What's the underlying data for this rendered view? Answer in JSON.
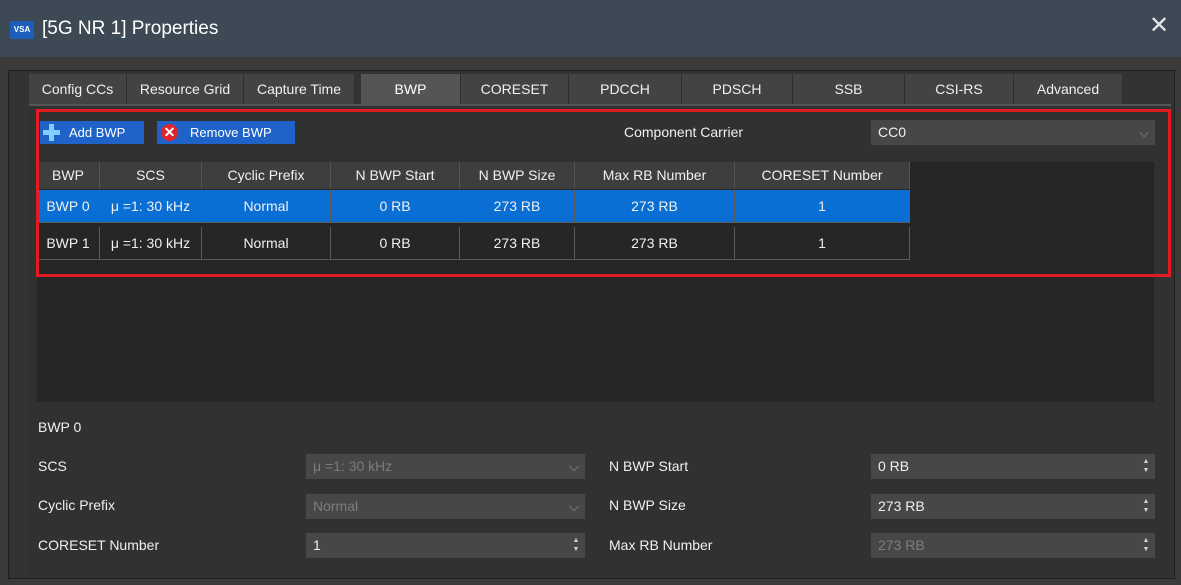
{
  "window": {
    "logo": "VSA",
    "title": "[5G NR 1] Properties",
    "close_glyph": "✕"
  },
  "tabs": [
    {
      "label": "Config CCs"
    },
    {
      "label": "Resource Grid"
    },
    {
      "label": "Capture Time"
    },
    {
      "label": "BWP"
    },
    {
      "label": "CORESET"
    },
    {
      "label": "PDCCH"
    },
    {
      "label": "PDSCH"
    },
    {
      "label": "SSB"
    },
    {
      "label": "CSI-RS"
    },
    {
      "label": "Advanced"
    }
  ],
  "active_tab": "BWP",
  "toolbar": {
    "add_label": "Add BWP",
    "remove_label": "Remove BWP",
    "remove_glyph": "✕"
  },
  "carrier": {
    "label": "Component Carrier",
    "value": "CC0",
    "chevron": "⌵"
  },
  "table": {
    "headers": [
      "BWP",
      "SCS",
      "Cyclic Prefix",
      "N BWP Start",
      "N BWP Size",
      "Max RB Number",
      "CORESET Number"
    ],
    "rows": [
      [
        "BWP 0",
        "μ =1: 30 kHz",
        "Normal",
        "0 RB",
        "273 RB",
        "273 RB",
        "1"
      ],
      [
        "BWP 1",
        "μ =1: 30 kHz",
        "Normal",
        "0 RB",
        "273 RB",
        "273 RB",
        "1"
      ]
    ],
    "selected_row": 0
  },
  "details": {
    "title": "BWP 0",
    "scs_label": "SCS",
    "scs_value": "μ =1: 30 kHz",
    "cp_label": "Cyclic Prefix",
    "cp_value": "Normal",
    "coreset_label": "CORESET Number",
    "coreset_value": "1",
    "start_label": "N BWP Start",
    "start_value": "0 RB",
    "size_label": "N BWP Size",
    "size_value": "273 RB",
    "maxrb_label": "Max RB Number",
    "maxrb_value": "273 RB"
  },
  "colors": {
    "selection": "#0a6fd4",
    "button": "#1f63c8",
    "highlight_border": "#e11b22"
  }
}
